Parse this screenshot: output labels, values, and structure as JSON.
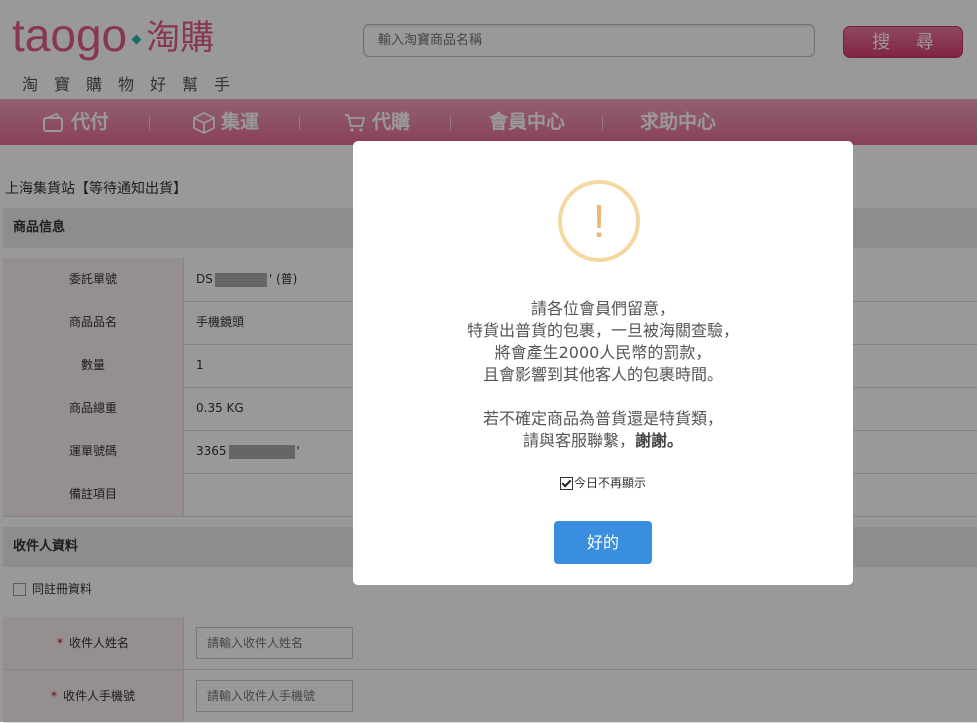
{
  "header": {
    "logo_text": "taogo",
    "logo_cn": "淘購",
    "slogan": "淘寶購物好幫手",
    "search_placeholder": "輸入淘寶商品名稱",
    "search_button": "搜 尋"
  },
  "nav": {
    "items": [
      {
        "label": "代付",
        "icon": "wallet-icon"
      },
      {
        "label": "集運",
        "icon": "box-icon"
      },
      {
        "label": "代購",
        "icon": "cart-icon"
      },
      {
        "label": "會員中心",
        "icon": ""
      },
      {
        "label": "求助中心",
        "icon": ""
      }
    ]
  },
  "page": {
    "title": "上海集貨站【等待通知出貨】",
    "product_section": "商品信息",
    "rows": [
      {
        "label": "委託單號",
        "value_prefix": "DS",
        "value_suffix": "' (普)"
      },
      {
        "label": "商品品名",
        "value": "手機鏡頭"
      },
      {
        "label": "數量",
        "value": "1"
      },
      {
        "label": "商品總重",
        "value": "0.35 KG"
      },
      {
        "label": "運單號碼",
        "value_prefix": "3365",
        "value_suffix": "'"
      },
      {
        "label": "備註項目",
        "value": ""
      }
    ],
    "recipient_section": "收件人資料",
    "same_as_registered": "同註冊資料",
    "form": [
      {
        "label": "收件人姓名",
        "placeholder": "請輸入收件人姓名"
      },
      {
        "label": "收件人手機號",
        "placeholder": "請輸入收件人手機號"
      }
    ]
  },
  "modal": {
    "icon": "warning-icon",
    "lines": [
      "請各位會員們留意，",
      "特貨出普貨的包裹，一旦被海關查驗，",
      "將會產生2000人民幣的罰款，",
      "且會影響到其他客人的包裹時間。"
    ],
    "lines2a": "若不確定商品為普貨還是特貨類，",
    "lines2b_plain": "請與客服聯繫，",
    "lines2b_bold": "謝謝。",
    "dont_show": "今日不再顯示",
    "ok_button": "好的"
  },
  "colors": {
    "brand_pink": "#e25d8a",
    "ok_blue": "#3a8ee0",
    "warning_ring": "#f5d7a1"
  }
}
